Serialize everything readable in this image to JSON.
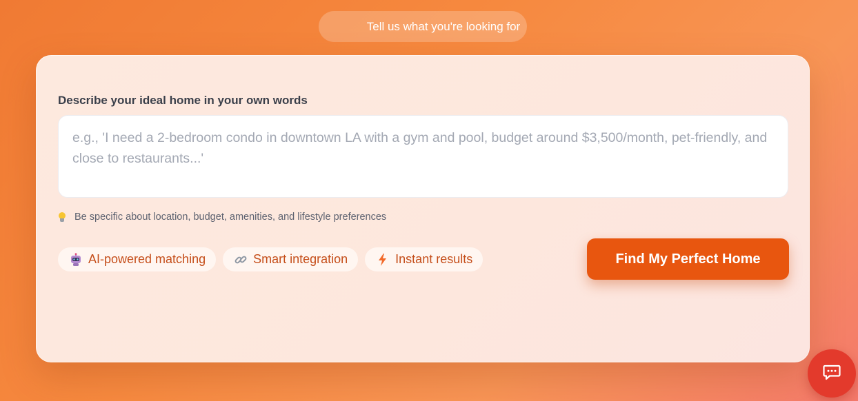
{
  "header": {
    "pill_text": "Tell us what you're looking for"
  },
  "form": {
    "label": "Describe your ideal home in your own words",
    "placeholder": "e.g., 'I need a 2-bedroom condo in downtown LA with a gym and pool, budget around $3,500/month, pet-friendly, and close to restaurants...'",
    "hint": "Be specific about location, budget, amenities, and lifestyle preferences",
    "hint_icon": "lightbulb-icon",
    "features": [
      {
        "label": "AI-powered matching",
        "icon": "robot-icon"
      },
      {
        "label": "Smart integration",
        "icon": "link-icon"
      },
      {
        "label": "Instant results",
        "icon": "lightning-icon"
      }
    ],
    "submit_label": "Find My Perfect Home"
  },
  "chat": {
    "icon": "chat-bubble-icon"
  },
  "colors": {
    "accent": "#e8560f",
    "chip_text": "#c54e1a",
    "chat_button": "#e33a2c"
  }
}
